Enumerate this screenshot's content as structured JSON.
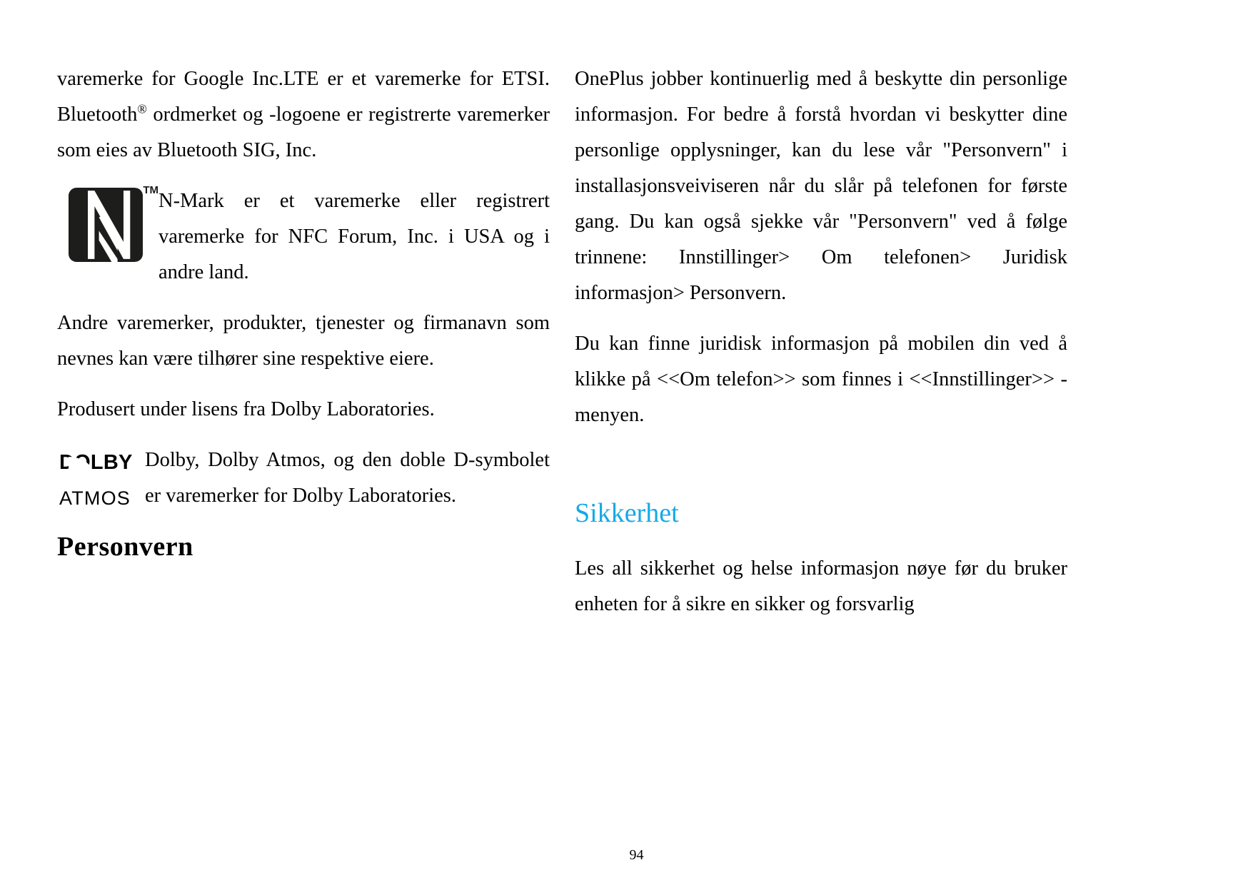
{
  "page": {
    "number": "94",
    "accent_color": "#16a9e6",
    "text_color": "#000000",
    "background_color": "#ffffff"
  },
  "left_column": {
    "paragraph_trademark_continued_1": "varemerke for Google Inc.LTE er et varemerke for ETSI. Bluetooth",
    "trademark_registered_symbol": "®",
    "paragraph_trademark_continued_2": " ordmerket og -logoene er registrerte varemerker som eies av Bluetooth SIG, Inc.",
    "nmark_logo": {
      "name": "N-Mark logo",
      "trademark_mark": "TM"
    },
    "paragraph_nmark": "N-Mark er et varemerke eller registrert varemerke for NFC Forum, Inc. i USA og i andre land.",
    "paragraph_other_trademarks": "Andre varemerker, produkter, tjenester og firmanavn som nevnes kan være tilhører sine respektive eiere.",
    "paragraph_dolby_license": "Produsert under lisens fra Dolby Laboratories.",
    "dolby_logo": {
      "name": "Dolby Atmos logo",
      "wordmark": "DOLBY",
      "submark": "ATMOS"
    },
    "paragraph_dolby_trademark": "Dolby, Dolby Atmos, og den doble D-symbolet er varemerker for Dolby Laboratories.",
    "heading_personvern": "Personvern"
  },
  "right_column": {
    "paragraph_privacy_1": "OnePlus jobber kontinuerlig med å beskytte din personlige informasjon. For bedre å forstå hvordan vi beskytter dine personlige opplysninger, kan du lese vår \"Personvern\" i installasjonsveiviseren når du slår på telefonen for første gang. Du kan også sjekke vår \"Personvern\" ved å følge trinnene: Innstillinger> Om telefonen> Juridisk informasjon> Personvern.",
    "paragraph_privacy_2": "Du kan finne juridisk informasjon på mobilen din ved å klikke på <<Om telefon>> som finnes i <<Innstillinger>> -menyen.",
    "heading_sikkerhet": "Sikkerhet",
    "paragraph_safety_1": "Les all sikkerhet og helse informasjon nøye før du bruker enheten for å sikre en sikker og forsvarlig"
  }
}
